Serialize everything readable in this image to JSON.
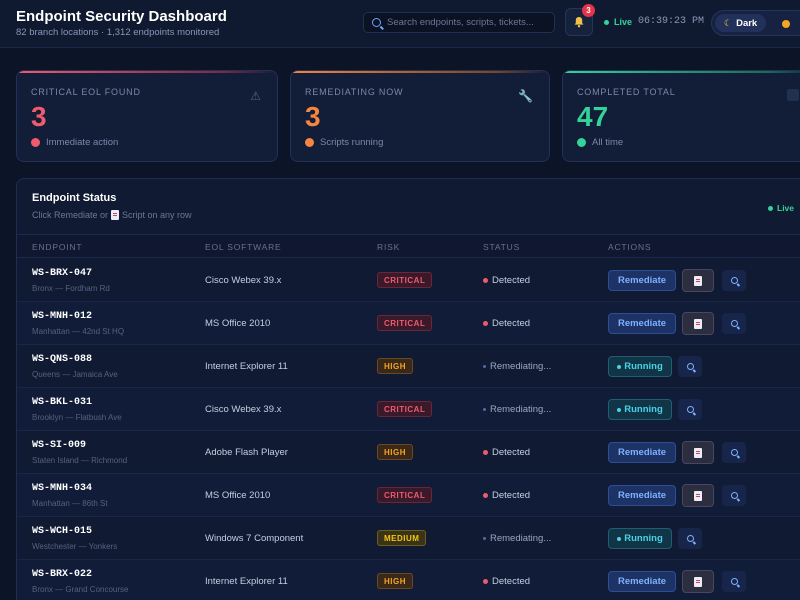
{
  "header": {
    "title": "Endpoint Security Dashboard",
    "subtitle": "82 branch locations · 1,312 endpoints monitored",
    "search_placeholder": "Search endpoints, scripts, tickets...",
    "notification_count": "3",
    "live_label": "Live",
    "clock": "06:39:23 PM",
    "theme_label": "Dark"
  },
  "stats": [
    {
      "label": "CRITICAL EOL FOUND",
      "value": "3",
      "caption": "Immediate action",
      "color": "#f05a6d",
      "icon": "warning-icon"
    },
    {
      "label": "REMEDIATING NOW",
      "value": "3",
      "caption": "Scripts running",
      "color": "#f5853f",
      "icon": "wrench-icon"
    },
    {
      "label": "COMPLETED TOTAL",
      "value": "47",
      "caption": "All time",
      "color": "#34d399",
      "icon": "check-icon"
    }
  ],
  "table": {
    "title": "Endpoint Status",
    "hint_before": "Click Remediate or",
    "hint_after": "Script on any row",
    "live_label": "Live",
    "columns": [
      "ENDPOINT",
      "EOL SOFTWARE",
      "RISK",
      "STATUS",
      "ACTIONS"
    ],
    "remediate_label": "Remediate",
    "running_label": "Running",
    "rows": [
      {
        "id": "WS-BRX-047",
        "location": "Bronx — Fordham Rd",
        "software": "Cisco Webex 39.x",
        "risk": "CRITICAL",
        "status": "Detected"
      },
      {
        "id": "WS-MNH-012",
        "location": "Manhattan — 42nd St HQ",
        "software": "MS Office 2010",
        "risk": "CRITICAL",
        "status": "Detected"
      },
      {
        "id": "WS-QNS-088",
        "location": "Queens — Jamaica Ave",
        "software": "Internet Explorer 11",
        "risk": "HIGH",
        "status": "Remediating..."
      },
      {
        "id": "WS-BKL-031",
        "location": "Brooklyn — Flatbush Ave",
        "software": "Cisco Webex 39.x",
        "risk": "CRITICAL",
        "status": "Remediating..."
      },
      {
        "id": "WS-SI-009",
        "location": "Staten Island — Richmond",
        "software": "Adobe Flash Player",
        "risk": "HIGH",
        "status": "Detected"
      },
      {
        "id": "WS-MNH-034",
        "location": "Manhattan — 86th St",
        "software": "MS Office 2010",
        "risk": "CRITICAL",
        "status": "Detected"
      },
      {
        "id": "WS-WCH-015",
        "location": "Westchester — Yonkers",
        "software": "Windows 7 Component",
        "risk": "MEDIUM",
        "status": "Remediating..."
      },
      {
        "id": "WS-BRX-022",
        "location": "Bronx — Grand Concourse",
        "software": "Internet Explorer 11",
        "risk": "HIGH",
        "status": "Detected"
      }
    ]
  }
}
